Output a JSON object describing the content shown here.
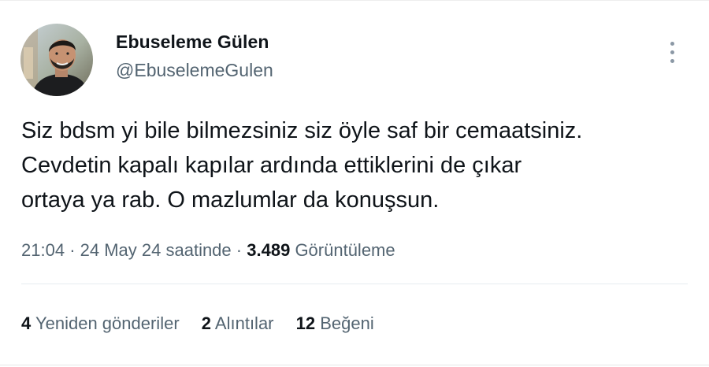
{
  "user": {
    "display_name": "Ebuseleme Gülen",
    "handle": "@EbuselemeGulen"
  },
  "tweet": {
    "lines": [
      "Siz bdsm yi bile bilmezsiniz siz öyle saf bir cemaatsiniz.",
      "Cevdetin kapalı kapılar ardında ettiklerini de çıkar",
      "ortaya ya rab. O mazlumlar da konuşsun."
    ]
  },
  "meta": {
    "time": "21:04",
    "separator": "·",
    "date_text": "24 May 24 saatinde",
    "views_count": "3.489",
    "views_label": "Görüntüleme"
  },
  "stats": {
    "retweets_count": "4",
    "retweets_label": "Yeniden gönderiler",
    "quotes_count": "2",
    "quotes_label": "Alıntılar",
    "likes_count": "12",
    "likes_label": "Beğeni"
  },
  "icons": {
    "more": "more-vertical-icon"
  },
  "colors": {
    "text_primary": "#0f1419",
    "text_secondary": "#536471",
    "icon_gray": "#8b98a5"
  }
}
